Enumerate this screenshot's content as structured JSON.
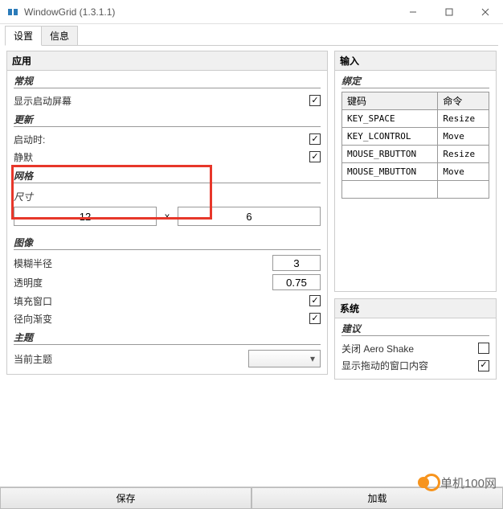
{
  "window": {
    "title": "WindowGrid (1.3.1.1)"
  },
  "tabs": {
    "settings": "设置",
    "info": "信息"
  },
  "left": {
    "header": "应用",
    "general": {
      "label": "常规",
      "showStartup": "显示启动屏幕",
      "showStartupChecked": true
    },
    "update": {
      "label": "更新",
      "onStart": "启动时:",
      "startChecked": true,
      "silent": "静默",
      "silentChecked": true
    },
    "grid": {
      "label": "网格",
      "size": "尺寸",
      "cols": "12",
      "rows": "6"
    },
    "image": {
      "label": "图像",
      "blur": "模糊半径",
      "blurVal": "3",
      "opacity": "透明度",
      "opacityVal": "0.75",
      "fill": "填充窗口",
      "fillChecked": true,
      "radial": "径向渐变",
      "radialChecked": true
    },
    "theme": {
      "label": "主题",
      "current": "当前主题",
      "value": ""
    }
  },
  "right": {
    "input": {
      "header": "输入",
      "bindings": "绑定",
      "colKey": "键码",
      "colCmd": "命令",
      "rows": [
        {
          "k": "KEY_SPACE",
          "c": "Resize"
        },
        {
          "k": "KEY_LCONTROL",
          "c": "Move"
        },
        {
          "k": "MOUSE_RBUTTON",
          "c": "Resize"
        },
        {
          "k": "MOUSE_MBUTTON",
          "c": "Move"
        },
        {
          "k": "",
          "c": ""
        }
      ]
    },
    "system": {
      "header": "系统",
      "advice": "建议",
      "aero": "关闭 Aero Shake",
      "aeroChecked": false,
      "dragContents": "显示拖动的窗口内容",
      "dragChecked": true
    }
  },
  "footer": {
    "save": "保存",
    "load": "加载"
  },
  "watermark": "单机100网"
}
